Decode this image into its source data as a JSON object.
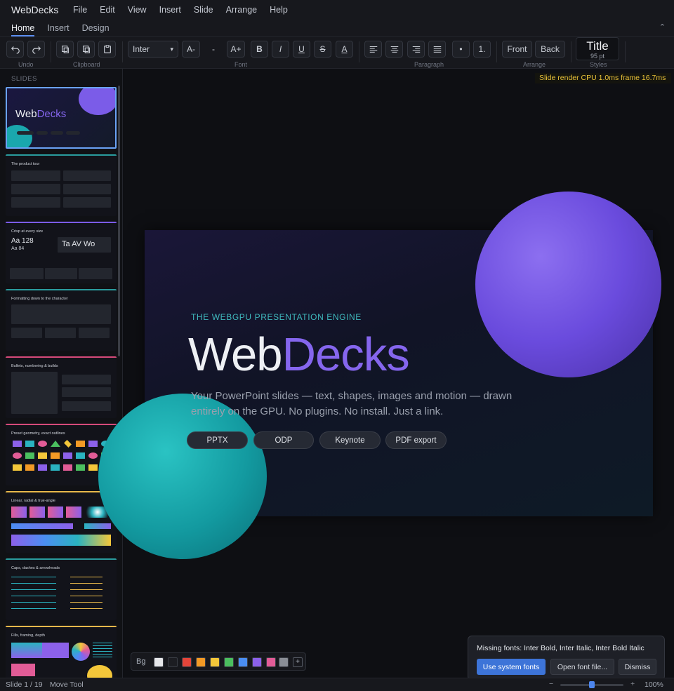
{
  "app": {
    "title": "WebDecks"
  },
  "menu": [
    "File",
    "Edit",
    "View",
    "Insert",
    "Slide",
    "Arrange",
    "Help"
  ],
  "tabs": [
    "Home",
    "Insert",
    "Design"
  ],
  "ribbon": {
    "font_name": "Inter",
    "font_decrease": "A-",
    "font_size": "-",
    "font_increase": "A+",
    "bold": "B",
    "italic": "I",
    "underline": "U",
    "strike": "S",
    "color": "A",
    "bullet": "•",
    "numbered": "1.",
    "front": "Front",
    "back": "Back",
    "style_title": "Title",
    "style_size": "95 pt",
    "labels": {
      "undo": "Undo",
      "clipboard": "Clipboard",
      "font": "Font",
      "paragraph": "Paragraph",
      "arrange": "Arrange",
      "styles": "Styles"
    }
  },
  "sidebar": {
    "label": "SLIDES",
    "thumbs": [
      {
        "title": "WebDecks",
        "accent": "#6aa2f5"
      },
      {
        "title": "The product tour",
        "accent": "#2a9c9e"
      },
      {
        "title": "Crisp at every size",
        "accent": "#7b5ce8"
      },
      {
        "title": "Formatting down to the character",
        "accent": "#2a9c9e"
      },
      {
        "title": "Bullets, numbering & builds",
        "accent": "#d64a7a"
      },
      {
        "title": "Preset geometry, exact outlines",
        "accent": "#d64a7a"
      },
      {
        "title": "Linear, radial & true-angle",
        "accent": "#e8b84a"
      },
      {
        "title": "Caps, dashes & arrowheads",
        "accent": "#2a9c9e"
      },
      {
        "title": "Fills, framing, depth",
        "accent": "#e8b84a"
      }
    ]
  },
  "perf": {
    "text": "Slide render  CPU 1.0ms  frame 16.7ms"
  },
  "slide": {
    "eyebrow": "THE WEBGPU PRESENTATION ENGINE",
    "title_a": "Web",
    "title_b": "Decks",
    "subtitle": "Your PowerPoint slides — text, shapes, images and motion — drawn entirely on the GPU. No plugins. No install. Just a link.",
    "pills": [
      "PPTX",
      "ODP",
      "Keynote",
      "PDF export"
    ]
  },
  "swatches": {
    "label": "Bg",
    "colors": [
      "#e6e7ea",
      "#1c1d22",
      "#e5453a",
      "#f39a25",
      "#f4c73a",
      "#4bbf5f",
      "#4b8ef2",
      "#8c61ea",
      "#e25c97",
      "#8a8e96"
    ],
    "add": "+"
  },
  "toast": {
    "message": "Missing fonts: Inter Bold, Inter Italic, Inter Bold Italic",
    "primary": "Use system fonts",
    "open": "Open font file...",
    "dismiss": "Dismiss"
  },
  "status": {
    "slide": "Slide 1 / 19",
    "tool": "Move Tool",
    "zoom": "100%",
    "zoom_minus": "−",
    "zoom_plus": "+",
    "zoom_value": 0.5
  }
}
